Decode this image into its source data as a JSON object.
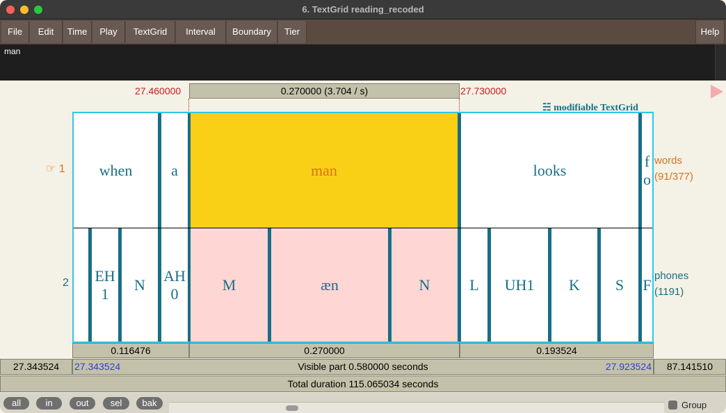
{
  "window": {
    "title": "6. TextGrid reading_recoded"
  },
  "menu": [
    "File",
    "Edit",
    "Time",
    "Play",
    "TextGrid",
    "Interval",
    "Boundary",
    "Tier"
  ],
  "help": "Help",
  "text_field": {
    "value": "man"
  },
  "selection": {
    "start": "27.460000",
    "end": "27.730000",
    "duration_label": "0.270000 (3.704 / s)"
  },
  "modifiable_label": "modifiable TextGrid",
  "tiers": [
    {
      "number": "1",
      "name": "words",
      "count": "(91/377)",
      "intervals": [
        "when",
        "a",
        "man",
        "looks",
        "f o"
      ]
    },
    {
      "number": "2",
      "name": "phones",
      "count": "(1191)",
      "intervals": [
        "EH 1",
        "N",
        "AH 0",
        "M",
        "æn",
        "N",
        "L",
        "UH1",
        "K",
        "S",
        "F"
      ]
    }
  ],
  "durations": [
    "0.116476",
    "0.270000",
    "0.193524"
  ],
  "visible": {
    "left_total": "27.343524",
    "start": "27.343524",
    "label": "Visible part 0.580000 seconds",
    "end": "27.923524",
    "right_total": "87.141510"
  },
  "total_label": "Total duration 115.065034 seconds",
  "buttons": [
    "all",
    "in",
    "out",
    "sel",
    "bak"
  ],
  "group_label": "Group",
  "colors": {
    "selection_fill": "#fad016",
    "selected_phone_fill": "#fed6d4",
    "tier_text": "#176e86",
    "selected_text": "#d8731a",
    "time_red": "#cc1a1a",
    "time_blue": "#2f3fd1"
  }
}
